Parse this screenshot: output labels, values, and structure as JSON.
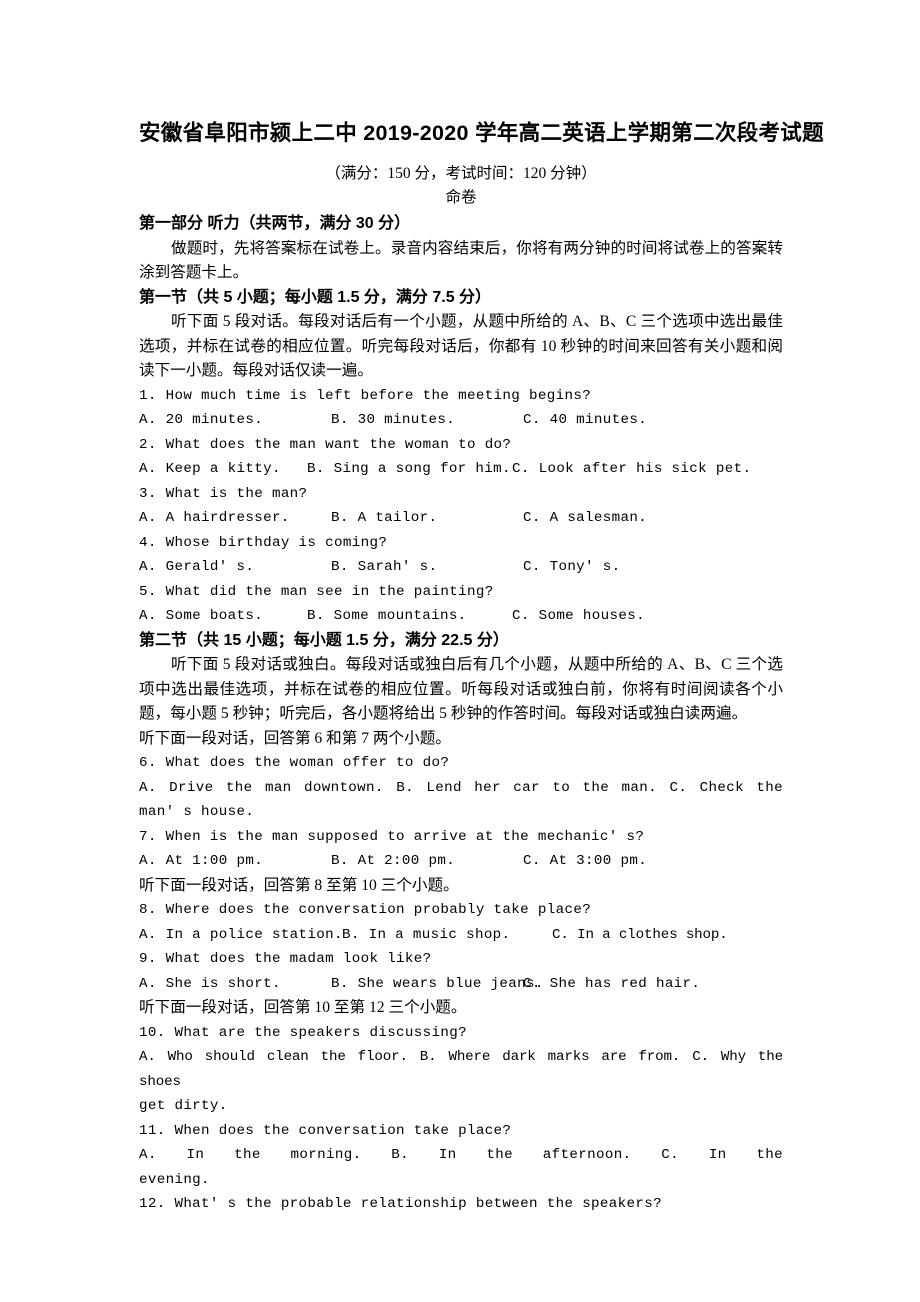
{
  "document": {
    "title": "安徽省阜阳市颍上二中 2019-2020 学年高二英语上学期第二次段考试题",
    "subtitle": "（满分：150 分，考试时间：120 分钟）",
    "byline": "命卷"
  },
  "part_one": {
    "heading": "第一部分   听力（共两节，满分 30 分）",
    "instruction": "做题时，先将答案标在试卷上。录音内容结束后，你将有两分钟的时间将试卷上的答案转涂到答题卡上。",
    "section_one": {
      "heading": "第一节（共 5 小题；每小题 1.5 分，满分 7.5 分）",
      "instruction": "听下面 5 段对话。每段对话后有一个小题，从题中所给的 A、B、C 三个选项中选出最佳选项，并标在试卷的相应位置。听完每段对话后，你都有 10 秒钟的时间来回答有关小题和阅读下一小题。每段对话仅读一遍。",
      "questions": [
        {
          "number": "1.",
          "stem": "1. How much time is left before the meeting begins?",
          "a": "A. 20 minutes.",
          "b": "B. 30 minutes.",
          "c": "C. 40 minutes."
        },
        {
          "number": "2.",
          "stem": "2. What does the man want the woman to do?",
          "a": "A. Keep a kitty.",
          "b": "B. Sing a song for him.",
          "c": "C. Look after his sick pet."
        },
        {
          "number": "3.",
          "stem": "3. What is the man?",
          "a": "A. A hairdresser.",
          "b": "B. A tailor.",
          "c": "C. A salesman."
        },
        {
          "number": "4.",
          "stem": "4. Whose birthday is coming?",
          "a": "A. Gerald' s.",
          "b": "B. Sarah' s.",
          "c": "C. Tony' s."
        },
        {
          "number": "5.",
          "stem": "5. What did the man see in the painting?",
          "a": "A. Some boats.",
          "b": "B. Some mountains.",
          "c": "C. Some houses."
        }
      ]
    },
    "section_two": {
      "heading": "第二节（共 15 小题；每小题 1.5 分，满分 22.5 分）",
      "instruction": "听下面 5 段对话或独白。每段对话或独白后有几个小题，从题中所给的 A、B、C 三个选项中选出最佳选项，并标在试卷的相应位置。听每段对话或独白前，你将有时间阅读各个小题，每小题 5 秒钟；听完后，各小题将给出 5 秒钟的作答时间。每段对话或独白读两遍。",
      "direction_6_7": "听下面一段对话，回答第 6 和第 7 两个小题。",
      "direction_8_10": "听下面一段对话，回答第 8 至第 10 三个小题。",
      "direction_10_12": "听下面一段对话，回答第 10 至第 12 三个小题。",
      "questions": [
        {
          "number": "6.",
          "stem": "6. What does the woman offer to do?",
          "a": "A. Drive the man downtown.",
          "b": "B. Lend her car to the man.",
          "c": "C.",
          "c_rest1": "Check",
          "c_rest2": "the",
          "c_cont": "man' s house."
        },
        {
          "number": "7.",
          "stem": "7. When is the man supposed to arrive at the mechanic' s?",
          "a": "A. At 1:00 pm.",
          "b": "B. At 2:00 pm.",
          "c": "C. At 3:00 pm."
        },
        {
          "number": "8.",
          "stem": "8. Where does the conversation probably take place?",
          "a": "A. In a police station.",
          "b": "B. In a music shop.",
          "c": "C. In a clothes shop."
        },
        {
          "number": "9.",
          "stem": "9. What does the madam look like?",
          "a": "A. She is short.",
          "b": "B. She wears blue jeans.",
          "c": "C. She has red hair."
        },
        {
          "number": "10.",
          "stem": "10. What are the speakers discussing?",
          "a": "A. Who should clean the floor.",
          "b": "B. Where dark marks are from.",
          "c": "C. Why the shoes",
          "c_cont": "get dirty."
        },
        {
          "number": "11.",
          "stem": "11. When does the conversation take place?",
          "a": "A. In the morning.",
          "b": "B. In the afternoon.",
          "c": "C.",
          "c_rest1": "In",
          "c_rest2": "the",
          "c_cont": "evening."
        },
        {
          "number": "12.",
          "stem": "12. What' s the probable relationship between the speakers?"
        }
      ]
    }
  }
}
